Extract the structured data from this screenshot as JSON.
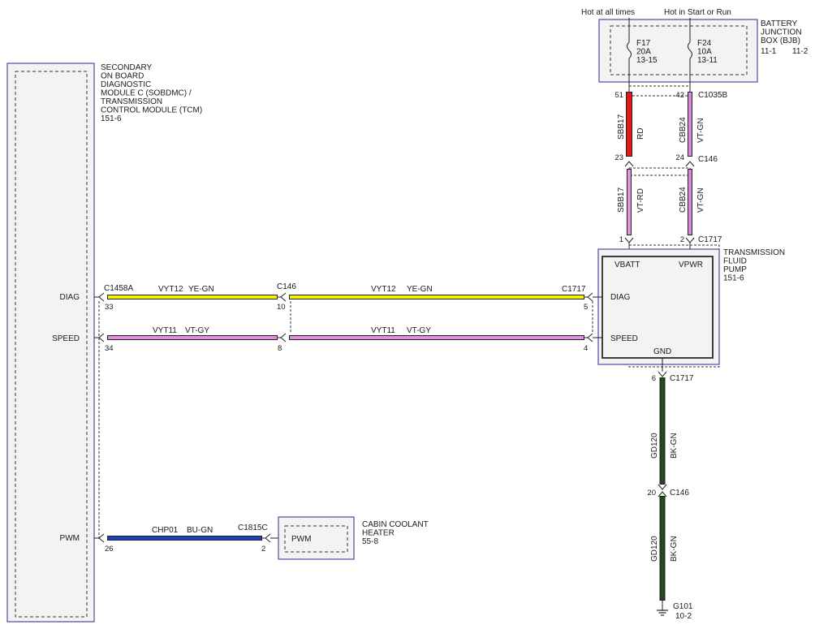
{
  "modules": {
    "sobdmc": {
      "label_lines": [
        "SECONDARY",
        "ON BOARD",
        "DIAGNOSTIC",
        "MODULE C (SOBDMC) /",
        "TRANSMISSION",
        "CONTROL MODULE (TCM)",
        "151-6"
      ],
      "pins": {
        "diag": "DIAG",
        "speed": "SPEED",
        "pwm": "PWM"
      }
    },
    "bjb": {
      "label_lines": [
        "BATTERY",
        "JUNCTION",
        "BOX (BJB)"
      ],
      "page_left": "11-1",
      "page_right": "11-2",
      "fuse_f17": [
        "F17",
        "20A",
        "13-15"
      ],
      "fuse_f24": [
        "F24",
        "10A",
        "13-11"
      ],
      "feed_left": "Hot at all times",
      "feed_right": "Hot in Start or Run"
    },
    "pump": {
      "label_lines": [
        "TRANSMISSION",
        "FLUID",
        "PUMP",
        "151-6"
      ],
      "pins": {
        "vbatt": "VBATT",
        "vpwr": "VPWR",
        "diag": "DIAG",
        "speed": "SPEED",
        "gnd": "GND"
      }
    },
    "heater": {
      "label_lines": [
        "CABIN COOLANT",
        "HEATER",
        "55-8"
      ],
      "pin": "PWM"
    },
    "ground": {
      "name": "G101",
      "page": "10-2"
    }
  },
  "connectors": {
    "c1458a": "C1458A",
    "c146": "C146",
    "c1717": "C1717",
    "c1035b": "C1035B",
    "c1815c": "C1815C"
  },
  "pins": {
    "p33": "33",
    "p34": "34",
    "p26": "26",
    "p10": "10",
    "p8": "8",
    "p5": "5",
    "p4": "4",
    "p51": "51",
    "p42": "42",
    "p23": "23",
    "p24": "24",
    "p1": "1",
    "p2": "2",
    "p6": "6",
    "p20": "20",
    "p2h": "2"
  },
  "wires": {
    "vyt12": {
      "circuit": "VYT12",
      "color_code": "YE-GN",
      "color": "#f2f200"
    },
    "vyt11": {
      "circuit": "VYT11",
      "color_code": "VT-GY",
      "color": "#e08fe0"
    },
    "chp01": {
      "circuit": "CHP01",
      "color_code": "BU-GN",
      "color": "#1c3fc8"
    },
    "sbb17_top": {
      "circuit": "SBB17",
      "color_code": "RD",
      "color": "#dd1a1a"
    },
    "cbb24_top": {
      "circuit": "CBB24",
      "color_code": "VT-GN",
      "color": "#d58ad8"
    },
    "sbb17_bot": {
      "circuit": "SBB17",
      "color_code": "VT-RD",
      "color": "#e596e0"
    },
    "cbb24_bot": {
      "circuit": "CBB24",
      "color_code": "VT-GN",
      "color": "#d58ad8"
    },
    "gd120_top": {
      "circuit": "GD120",
      "color_code": "BK-GN",
      "color": "#1f4a1f"
    },
    "gd120_bot": {
      "circuit": "GD120",
      "color_code": "BK-GN",
      "color": "#1f4a1f"
    }
  }
}
